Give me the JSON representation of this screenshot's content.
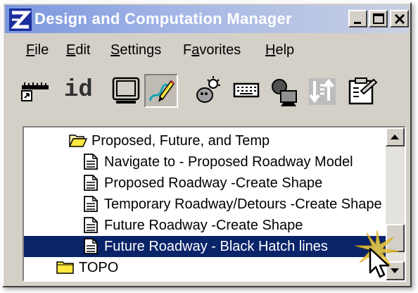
{
  "window": {
    "title": "Design and Computation Manager",
    "controls": {
      "minimize": "_",
      "maximize": "□",
      "close": "X"
    }
  },
  "menu": [
    {
      "id": "file",
      "accel": "F",
      "rest": "ile"
    },
    {
      "id": "edit",
      "accel": "E",
      "rest": "dit"
    },
    {
      "id": "settings",
      "accel": "S",
      "rest": "ettings"
    },
    {
      "id": "favorites",
      "pre": "F",
      "accel": "a",
      "rest": "vorites"
    },
    {
      "id": "help",
      "accel": "H",
      "rest": "elp"
    }
  ],
  "toolbar": {
    "id_label": "id",
    "tools": [
      "ruler-icon",
      "id-icon",
      "monitor-icon",
      "pencil-draw-icon",
      "idea-icon",
      "keyboard-icon",
      "display-filter-icon",
      "sort-icon",
      "clipboard-settings-icon"
    ]
  },
  "tree": {
    "folder_open": {
      "label": "Proposed, Future, and Temp"
    },
    "items": [
      {
        "label": "Navigate to - Proposed Roadway Model"
      },
      {
        "label": "Proposed Roadway -Create Shape"
      },
      {
        "label": "Temporary Roadway/Detours -Create Shape"
      },
      {
        "label": "Future Roadway -Create Shape"
      },
      {
        "label": "Future Roadway - Black Hatch lines",
        "selected": true
      }
    ],
    "folder_closed": {
      "label": "TOPO"
    }
  },
  "colors": {
    "selection": "#0a246a",
    "title_gradient_start": "#7a96df",
    "face": "#d4d0c8"
  }
}
